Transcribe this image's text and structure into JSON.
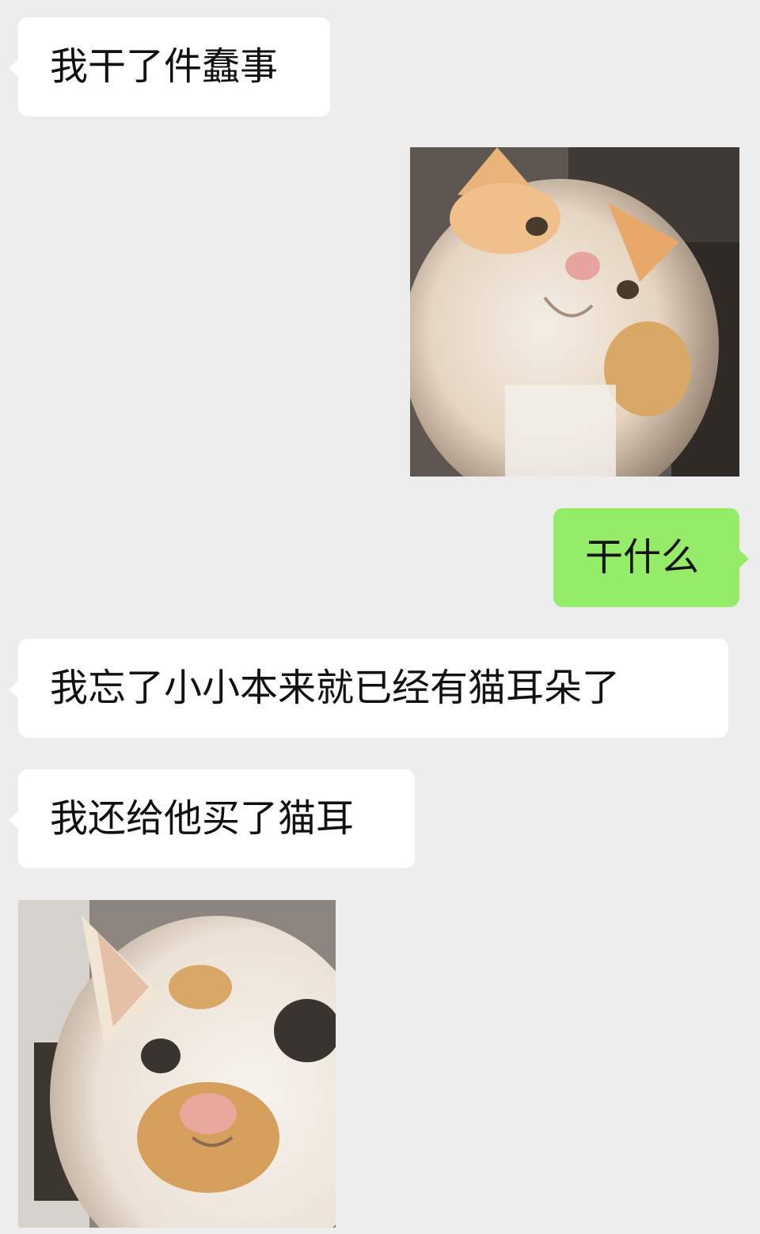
{
  "messages": [
    {
      "side": "left",
      "type": "text",
      "text": "我干了件蠢事"
    },
    {
      "side": "right",
      "type": "image",
      "image": "cat-looking-up-image"
    },
    {
      "side": "right",
      "type": "text",
      "text": "干什么"
    },
    {
      "side": "left",
      "type": "text",
      "text": "我忘了小小本来就已经有猫耳朵了"
    },
    {
      "side": "left",
      "type": "text",
      "text": "我还给他买了猫耳"
    },
    {
      "side": "left",
      "type": "image",
      "image": "cat-closeup-image"
    }
  ],
  "colors": {
    "background": "#ededed",
    "incoming_bubble": "#ffffff",
    "outgoing_bubble": "#95ec69",
    "text": "#111111"
  }
}
